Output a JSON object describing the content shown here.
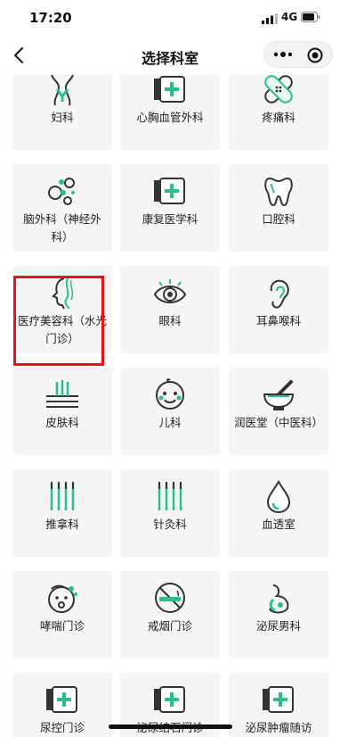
{
  "status_bar": {
    "time": "17:20",
    "network": "4G"
  },
  "nav": {
    "title": "选择科室"
  },
  "colors": {
    "accent": "#28c08a",
    "highlight": "#e5141c",
    "card_bg": "#f5f5f5"
  },
  "departments": [
    {
      "label": "妇科",
      "icon": "female-body-icon"
    },
    {
      "label": "心胸血管外科",
      "icon": "medical-kit-icon"
    },
    {
      "label": "疼痛科",
      "icon": "bandage-icon"
    },
    {
      "label": "脑外科（神经外科）",
      "icon": "bubbles-icon"
    },
    {
      "label": "康复医学科",
      "icon": "medical-kit-icon"
    },
    {
      "label": "口腔科",
      "icon": "tooth-icon"
    },
    {
      "label": "医疗美容科（水光门诊）",
      "icon": "face-profile-icon"
    },
    {
      "label": "眼科",
      "icon": "eye-icon"
    },
    {
      "label": "耳鼻喉科",
      "icon": "ear-icon"
    },
    {
      "label": "皮肤科",
      "icon": "skin-hair-icon"
    },
    {
      "label": "儿科",
      "icon": "baby-face-icon"
    },
    {
      "label": "润医堂（中医科）",
      "icon": "mortar-pestle-icon"
    },
    {
      "label": "推拿科",
      "icon": "needles-icon"
    },
    {
      "label": "针灸科",
      "icon": "needles-icon"
    },
    {
      "label": "血透室",
      "icon": "blood-drop-icon"
    },
    {
      "label": "哮喘门诊",
      "icon": "asthma-face-icon"
    },
    {
      "label": "戒烟门诊",
      "icon": "no-smoking-icon"
    },
    {
      "label": "泌尿男科",
      "icon": "urology-icon"
    },
    {
      "label": "尿控门诊",
      "icon": "medical-kit-icon"
    },
    {
      "label": "泌尿结石门诊",
      "icon": "medical-kit-icon"
    },
    {
      "label": "泌尿肿瘤随访",
      "icon": "medical-kit-icon"
    }
  ]
}
